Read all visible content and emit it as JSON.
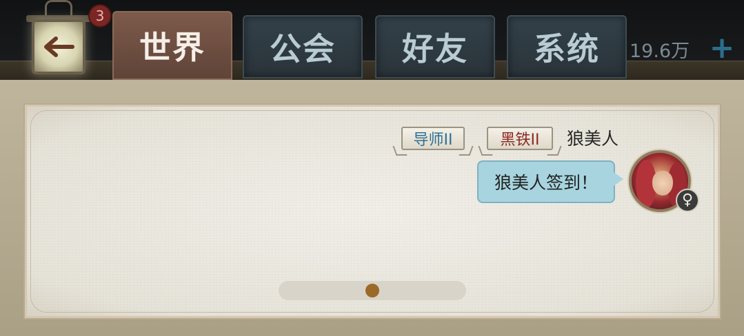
{
  "tabs": [
    {
      "label": "世界",
      "active": true
    },
    {
      "label": "公会",
      "active": false
    },
    {
      "label": "好友",
      "active": false
    },
    {
      "label": "系统",
      "active": false
    }
  ],
  "back_badge": "3",
  "currency": {
    "value": "19.6万",
    "plus": "+"
  },
  "message": {
    "titles": [
      "导师II",
      "黑铁II"
    ],
    "sender": "狼美人",
    "text": "狼美人签到！",
    "gender_symbol": "♀"
  },
  "scroll": {
    "position_fraction": 0.5
  },
  "colors": {
    "active_tab": "#6e4f41",
    "inactive_tab": "#2f3b42",
    "bubble": "#a7d4df",
    "paper": "#ebe8df",
    "mentor_title": "#2e6f95",
    "rank_title": "#8c2a24"
  }
}
